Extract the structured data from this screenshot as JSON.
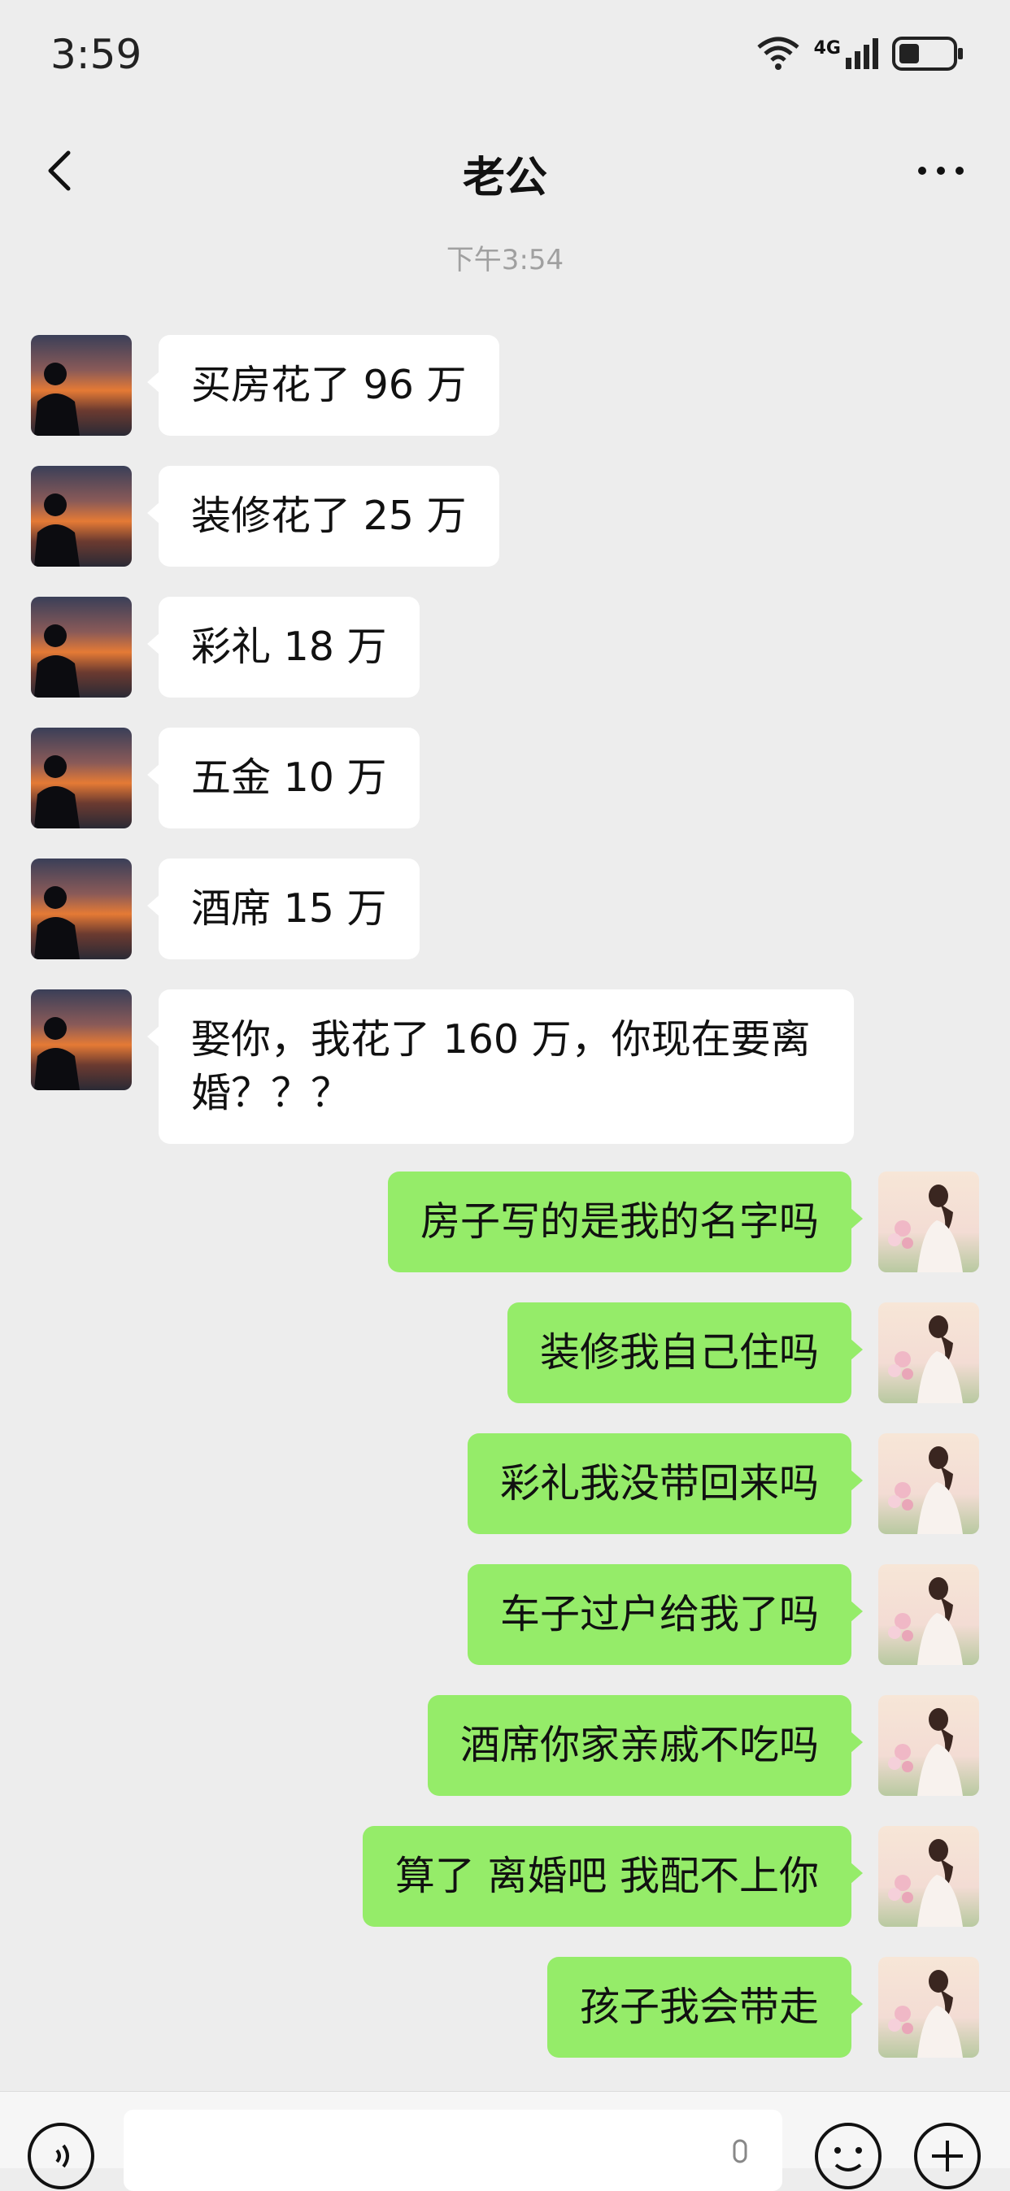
{
  "status_bar": {
    "time": "3:59",
    "network": "4G"
  },
  "header": {
    "title": "老公"
  },
  "timestamp": "下午3:54",
  "messages_received": [
    "买房花了 96 万",
    "装修花了 25 万",
    "彩礼 18 万",
    "五金 10 万",
    "酒席 15 万",
    "娶你，我花了 160 万，你现在要离婚？？？"
  ],
  "messages_sent": [
    "房子写的是我的名字吗",
    "装修我自己住吗",
    "彩礼我没带回来吗",
    "车子过户给我了吗",
    "酒席你家亲戚不吃吗",
    "算了 离婚吧 我配不上你",
    "孩子我会带走"
  ],
  "colors": {
    "sent_bubble": "#95ec69",
    "received_bubble": "#ffffff",
    "background": "#ededed"
  },
  "icons": {
    "back": "back-chevron-icon",
    "more": "more-dots-icon",
    "voice": "voice-icon",
    "emoji": "emoji-icon",
    "plus": "plus-icon",
    "wifi": "wifi-icon",
    "signal": "signal-icon",
    "battery": "battery-icon"
  }
}
